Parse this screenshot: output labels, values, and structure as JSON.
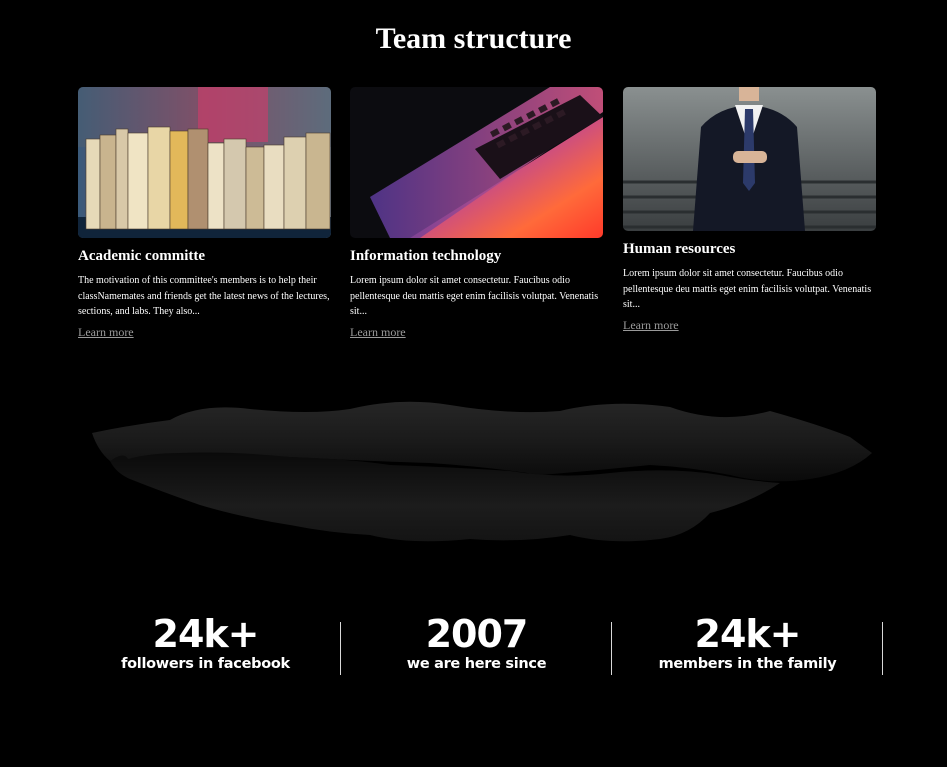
{
  "page": {
    "title": "Team structure"
  },
  "cards": [
    {
      "title": "Academic committe",
      "text": "The motivation of this committee's members is to help their classNamemates and friends get the latest news of the lectures, sections, and labs. They also...",
      "link": "Learn more",
      "image": "books-on-shelf-photo"
    },
    {
      "title": "Information technology",
      "text": "Lorem ipsum dolor sit amet consectetur. Faucibus odio pellentesque deu mattis eget enim facilisis volutpat. Venenatis sit...",
      "link": "Learn more",
      "image": "laptop-keyboard-photo"
    },
    {
      "title": "Human resources",
      "text": "Lorem ipsum dolor sit amet consectetur. Faucibus odio pellentesque deu mattis eget enim facilisis volutpat. Venenatis sit...",
      "link": "Learn more",
      "image": "businessman-suit-photo"
    }
  ],
  "stats": [
    {
      "value": "24k+",
      "label": "followers in facebook"
    },
    {
      "value": "2007",
      "label": "we are here since"
    },
    {
      "value": "24k+",
      "label": "members in the family"
    }
  ],
  "colors": {
    "background": "#000000",
    "text": "#ffffff",
    "link": "#9a9a9a"
  }
}
